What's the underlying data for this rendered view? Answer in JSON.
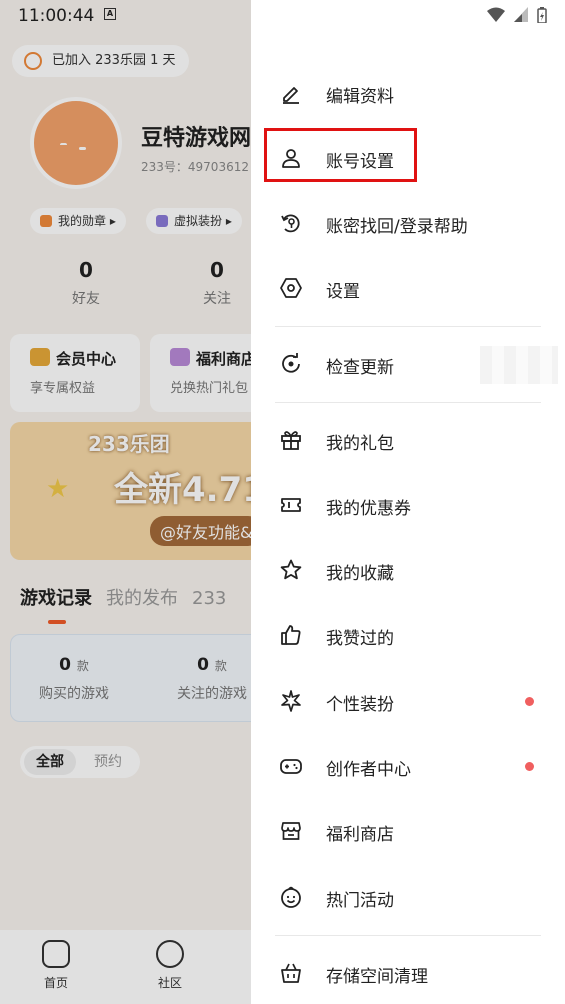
{
  "status_bar": {
    "time": "11:00:44",
    "indicator": "A"
  },
  "background": {
    "join_chip": "已加入 233乐园 1 天",
    "user": {
      "name": "豆特游戏网",
      "id_text": "233号：49703612"
    },
    "pills": [
      "我的勋章",
      "虚拟装扮"
    ],
    "stats": [
      {
        "value": "0",
        "label": "好友"
      },
      {
        "value": "0",
        "label": "关注"
      }
    ],
    "cards": [
      {
        "title": "会员中心",
        "subtitle": "享专属权益"
      },
      {
        "title": "福利商店",
        "subtitle": "兑换热门礼包"
      }
    ],
    "banner": {
      "brand": "233乐团",
      "headline": "全新4.71",
      "tag": "@好友功能&"
    },
    "tabs": [
      "游戏记录",
      "我的发布",
      "233"
    ],
    "game_stats": [
      {
        "value": "0",
        "unit": "款",
        "label": "购买的游戏"
      },
      {
        "value": "0",
        "unit": "款",
        "label": "关注的游戏"
      }
    ],
    "filters": {
      "active": "全部",
      "inactive": "预约"
    },
    "bottom_nav": [
      "首页",
      "社区"
    ]
  },
  "drawer": {
    "items": [
      {
        "label": "编辑资料",
        "icon": "edit-icon",
        "dot": false
      },
      {
        "label": "账号设置",
        "icon": "person-icon",
        "dot": false
      },
      {
        "label": "账密找回/登录帮助",
        "icon": "key-refresh-icon",
        "dot": false
      },
      {
        "label": "设置",
        "icon": "settings-hex-icon",
        "dot": false
      },
      {
        "label": "检查更新",
        "icon": "update-icon",
        "dot": false
      },
      {
        "label": "我的礼包",
        "icon": "gift-icon",
        "dot": false
      },
      {
        "label": "我的优惠券",
        "icon": "coupon-icon",
        "dot": false
      },
      {
        "label": "我的收藏",
        "icon": "star-icon",
        "dot": false
      },
      {
        "label": "我赞过的",
        "icon": "thumbs-up-icon",
        "dot": false
      },
      {
        "label": "个性装扮",
        "icon": "sparkle-icon",
        "dot": true
      },
      {
        "label": "创作者中心",
        "icon": "gamepad-icon",
        "dot": true
      },
      {
        "label": "福利商店",
        "icon": "store-icon",
        "dot": false
      },
      {
        "label": "热门活动",
        "icon": "smile-icon",
        "dot": false
      },
      {
        "label": "存储空间清理",
        "icon": "basket-icon",
        "dot": false
      }
    ],
    "highlight_color": "#e01212",
    "notification_dot_color": "#f05f5f"
  }
}
